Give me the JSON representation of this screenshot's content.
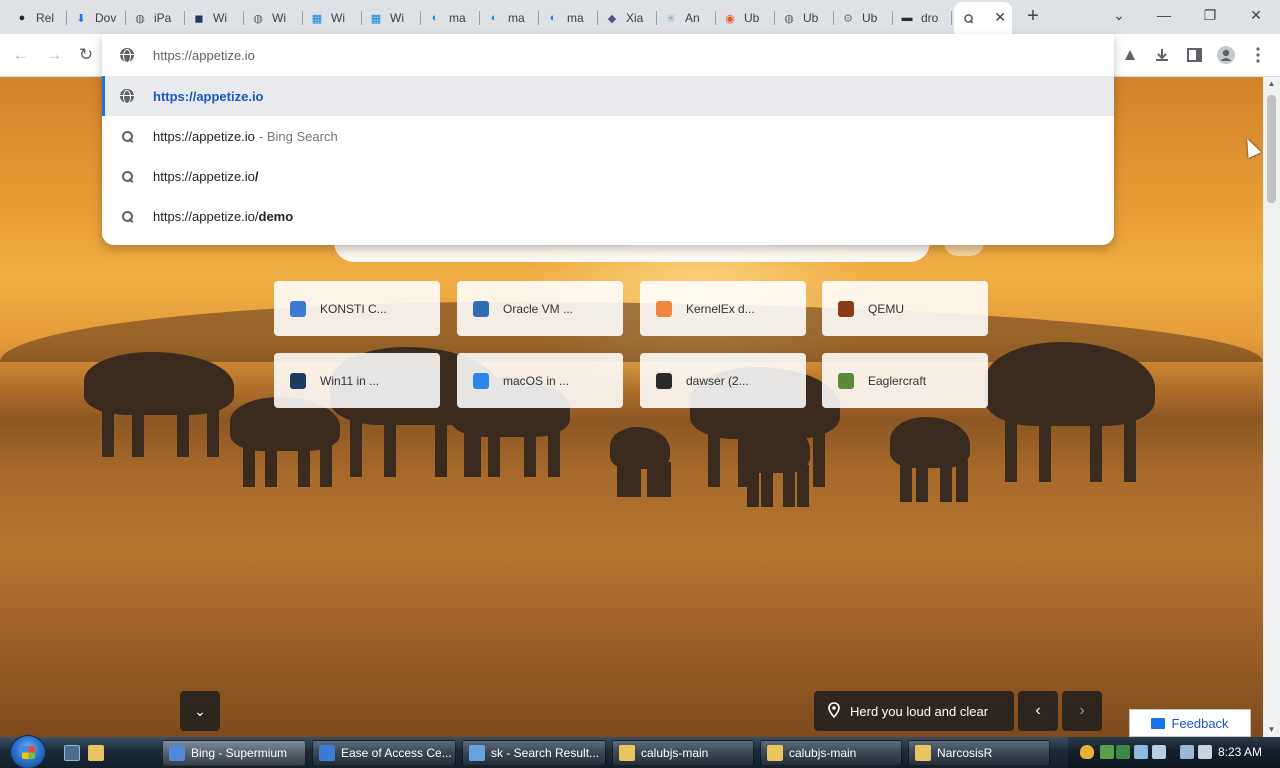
{
  "tabs": [
    {
      "label": "Rel",
      "icon": "github-icon",
      "color": "#24292f",
      "glyph": "●"
    },
    {
      "label": "Dov",
      "icon": "download-icon",
      "color": "#1a73e8",
      "glyph": "⬇"
    },
    {
      "label": "iPa",
      "icon": "globe-icon",
      "color": "#5f6368",
      "glyph": "◍"
    },
    {
      "label": "Wi",
      "icon": "vmware-icon",
      "color": "#1d3b5c",
      "glyph": "◼"
    },
    {
      "label": "Wi",
      "icon": "globe-icon",
      "color": "#5f6368",
      "glyph": "◍"
    },
    {
      "label": "Wi",
      "icon": "windows-icon",
      "color": "#0a84d6",
      "glyph": "▦"
    },
    {
      "label": "Wi",
      "icon": "windows-icon",
      "color": "#0a84d6",
      "glyph": "▦"
    },
    {
      "label": "ma",
      "icon": "finder-icon",
      "color": "#2b86e8",
      "glyph": "◐"
    },
    {
      "label": "ma",
      "icon": "finder-icon",
      "color": "#2b86e8",
      "glyph": "◐"
    },
    {
      "label": "ma",
      "icon": "finder-icon",
      "color": "#2b86e8",
      "glyph": "◐"
    },
    {
      "label": "Xia",
      "icon": "xiaomi-icon",
      "color": "#5b4b8a",
      "glyph": "◆"
    },
    {
      "label": "An",
      "icon": "android-icon",
      "color": "#7aa7c7",
      "glyph": "✳"
    },
    {
      "label": "Ub",
      "icon": "ubuntu-icon",
      "color": "#e95420",
      "glyph": "◉"
    },
    {
      "label": "Ub",
      "icon": "globe-icon",
      "color": "#5f6368",
      "glyph": "◍"
    },
    {
      "label": "Ub",
      "icon": "gear-icon",
      "color": "#7a7a7a",
      "glyph": "⚙"
    },
    {
      "label": "dro",
      "icon": "terminal-icon",
      "color": "#2b2b2b",
      "glyph": "▬"
    }
  ],
  "active_tab": {
    "icon": "search-icon",
    "close": "✕"
  },
  "window": {
    "new_tab": "+",
    "tab_search": "⌄",
    "minimize": "—",
    "restore": "❐",
    "close": "✕"
  },
  "toolbar": {
    "back": "←",
    "forward": "→",
    "reload": "↻"
  },
  "omnibox": {
    "value": "https://appetize.io",
    "suggestions": [
      {
        "main": "https://appetize.io",
        "dim": "",
        "bold": "",
        "icon": "globe-icon",
        "selected": true
      },
      {
        "main": "https://appetize.io",
        "dim": "- Bing Search",
        "bold": "",
        "icon": "search-icon",
        "selected": false
      },
      {
        "main": "https://appetize.io",
        "dim": "",
        "bold": "/",
        "icon": "search-icon",
        "selected": false
      },
      {
        "main": "https://appetize.io/",
        "dim": "",
        "bold": "demo",
        "icon": "search-icon",
        "selected": false
      }
    ]
  },
  "quick_links": [
    {
      "label": "KONSTI C...",
      "icon": "konsti-icon",
      "color": "#3b7bd4"
    },
    {
      "label": "Oracle VM ...",
      "icon": "virtualbox-icon",
      "color": "#2f6db5"
    },
    {
      "label": "KernelEx d...",
      "icon": "kernelex-icon",
      "color": "#f0873a"
    },
    {
      "label": "QEMU",
      "icon": "qemu-icon",
      "color": "#8a3a16"
    },
    {
      "label": "Win11 in ...",
      "icon": "vmware-icon",
      "color": "#1d3b5c"
    },
    {
      "label": "macOS in ...",
      "icon": "finder-icon",
      "color": "#2b86e8"
    },
    {
      "label": "dawser (2...",
      "icon": "terminal-icon",
      "color": "#2b2b2b"
    },
    {
      "label": "Eaglercraft",
      "icon": "minecraft-icon",
      "color": "#5a8a3a"
    }
  ],
  "background": {
    "caption": "Herd you loud and clear",
    "prev": "‹",
    "next": "›",
    "expand": "⌄"
  },
  "feedback": {
    "label": "Feedback"
  },
  "taskbar": {
    "buttons": [
      {
        "label": "Bing - Supermium",
        "color": "#4d8bd8",
        "active": true
      },
      {
        "label": "Ease of Access Ce...",
        "color": "#3a7bd5",
        "active": false
      },
      {
        "label": "sk - Search Result...",
        "color": "#6aa1e0",
        "active": false
      },
      {
        "label": "calubjs-main",
        "color": "#e8c560",
        "active": false
      },
      {
        "label": "calubjs-main",
        "color": "#e8c560",
        "active": false
      },
      {
        "label": "NarcosisR",
        "color": "#e8c560",
        "active": false
      }
    ],
    "clock": "8:23 AM"
  }
}
